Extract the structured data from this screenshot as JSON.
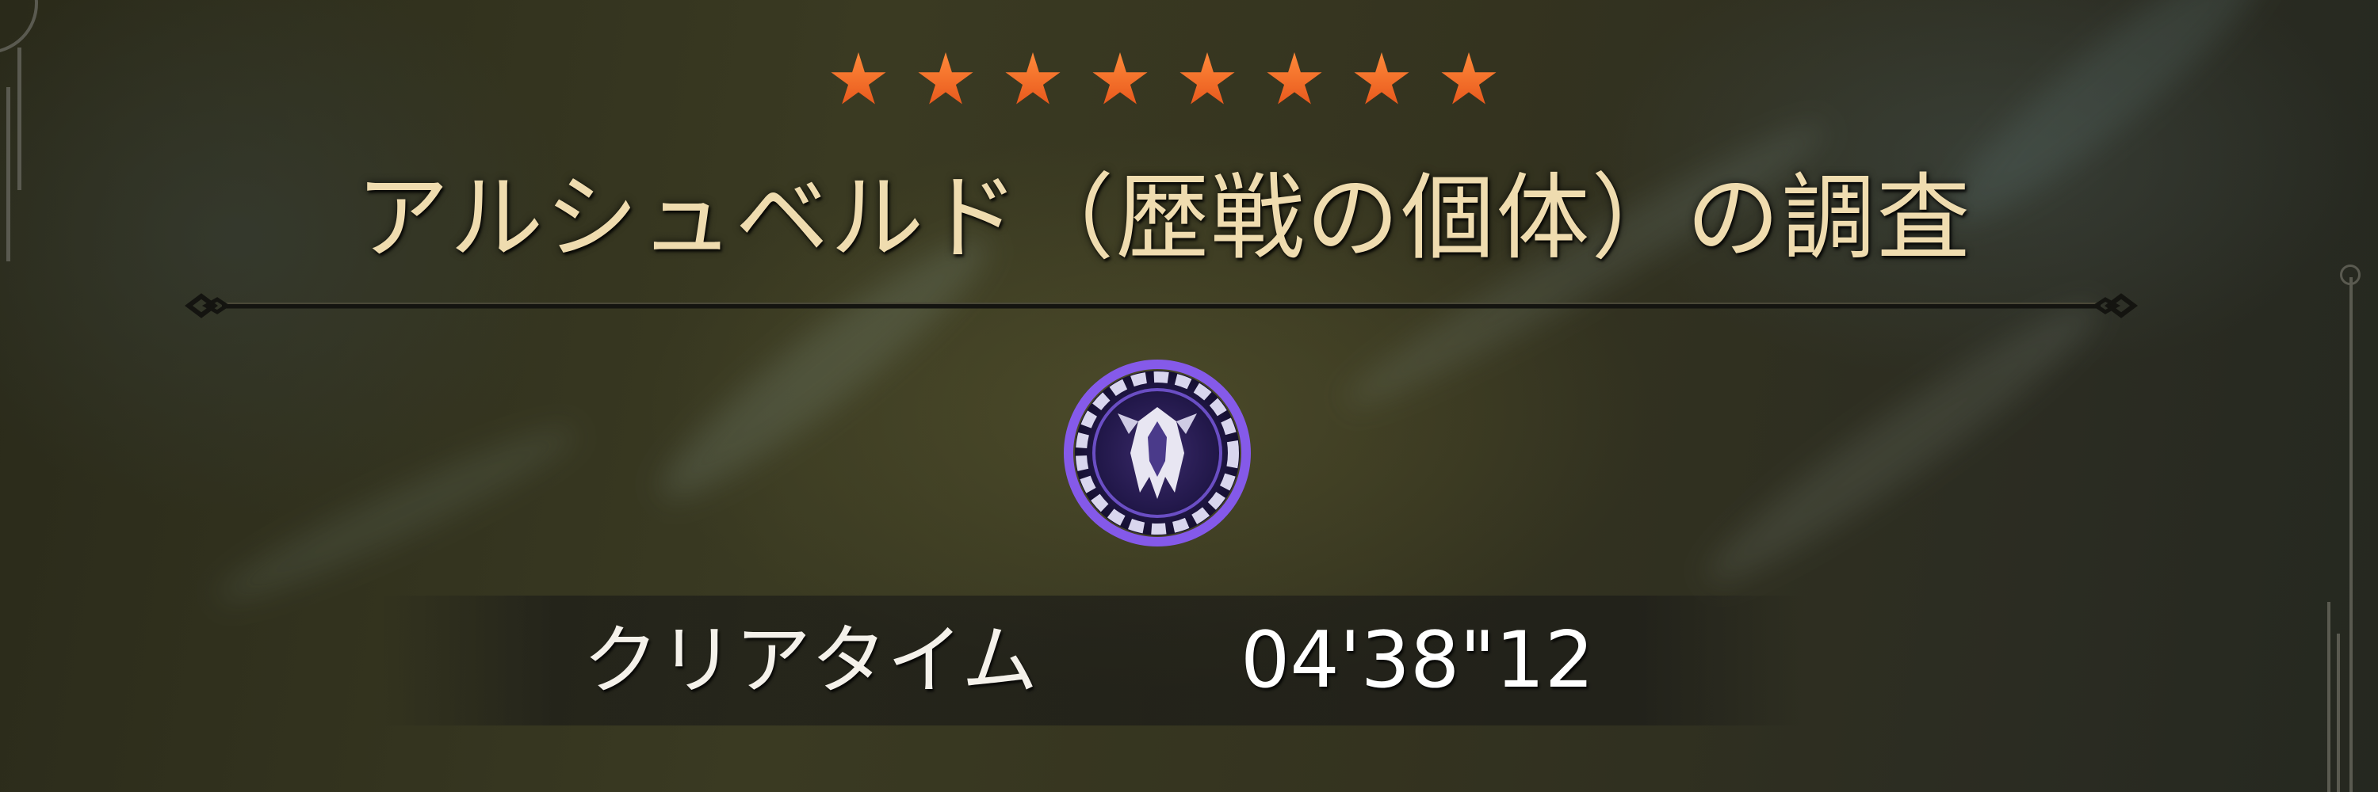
{
  "quest": {
    "rank_stars": 8,
    "title": "アルシュベルド（歴戦の個体）の調査",
    "monster_icon": "arkveld-monster-icon",
    "clear_time_label": "クリアタイム",
    "clear_time_value": "04'38\"12"
  },
  "colors": {
    "star": "#f0661e",
    "title": "#efdcaf",
    "emblem_glow": "#8c5cff"
  }
}
